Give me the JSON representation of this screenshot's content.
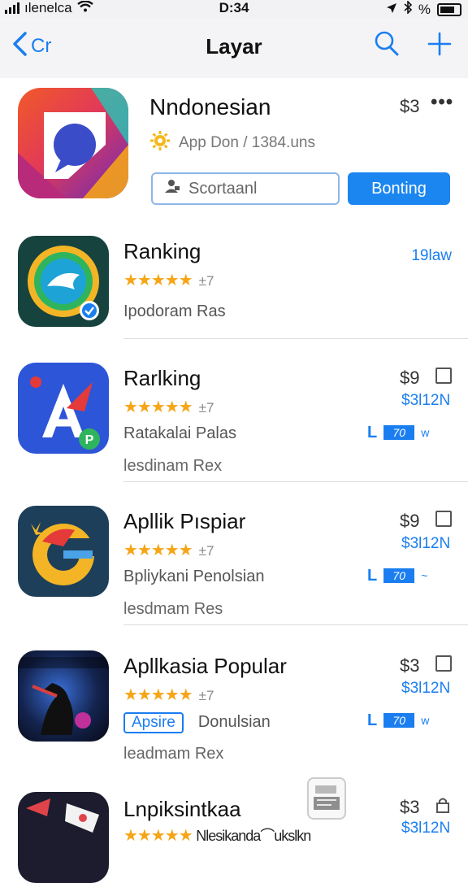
{
  "status_bar": {
    "carrier": "ılenelca",
    "time": "D:34",
    "battery_pct": "%"
  },
  "nav": {
    "back_label": "Cr",
    "title": "Layar"
  },
  "hero": {
    "title": "Nndonesian",
    "subtitle": "App Don / 1384.uns",
    "price": "$3",
    "more": "•••",
    "search_button": "Scortaanl",
    "primary_button": "Bonting"
  },
  "rows": [
    {
      "title": "Ranking",
      "rating_count": "±7",
      "line3": "Ipodoram Ras",
      "right_text": "19law"
    },
    {
      "title": "Rarlking",
      "rating_count": "±7",
      "price": "$9",
      "sub": "$3l12N",
      "line3": "Ratakalai Palas",
      "line4": "lesdinam Rex",
      "tag_letter": "L",
      "tag_box": "70",
      "tag_extra": "w"
    },
    {
      "title": "Apllik Pıspiar",
      "rating_count": "±7",
      "price": "$9",
      "sub": "$3l12N",
      "line3": "Bpliykani  Penolsian",
      "line4": "lesdmam Res",
      "tag_letter": "L",
      "tag_box": "70",
      "tag_extra": "~"
    },
    {
      "title": "Apllkasia Popular",
      "rating_count": "±7",
      "price": "$3",
      "sub": "$3l12N",
      "chip": "Apsire",
      "line3": "Donulsian",
      "line4": "leadmam Rex",
      "tag_letter": "L",
      "tag_box": "70",
      "tag_extra": "w"
    },
    {
      "title": "Lnpiksintkaa",
      "price": "$3",
      "sub": "$3l12N",
      "line3": "Nlesikanda⌒ukslkn"
    }
  ],
  "icons": {
    "search": "search-icon",
    "add": "plus-icon",
    "back": "chevron-left-icon"
  },
  "colors": {
    "accent": "#1a7ef0",
    "star": "#f5a516"
  }
}
